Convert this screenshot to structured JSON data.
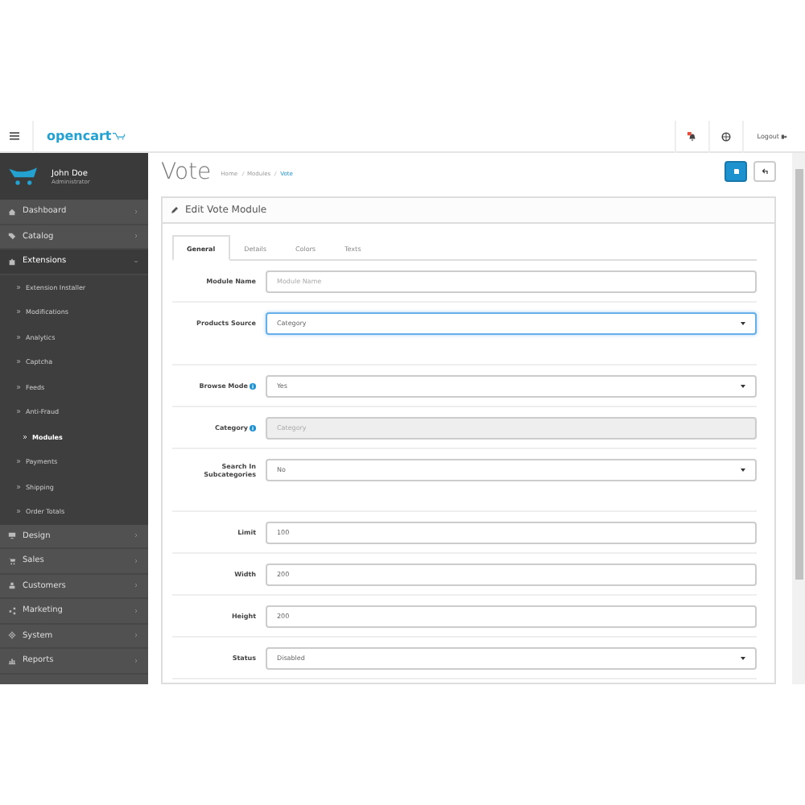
{
  "header": {
    "logo": "opencart",
    "logout": "Logout",
    "notification": true
  },
  "profile": {
    "name": "John Doe",
    "role": "Administrator"
  },
  "nav": [
    {
      "label": "Dashboard",
      "expanded": false,
      "selected": false
    },
    {
      "label": "Catalog",
      "expanded": false,
      "selected": false
    },
    {
      "label": "Extensions",
      "expanded": true,
      "selected": true,
      "children": [
        {
          "label": "Extension Installer",
          "selected": false
        },
        {
          "label": "Modifications",
          "selected": false
        },
        {
          "label": "Analytics",
          "selected": false
        },
        {
          "label": "Captcha",
          "selected": false
        },
        {
          "label": "Feeds",
          "selected": false
        },
        {
          "label": "Anti-Fraud",
          "selected": false
        },
        {
          "label": "Modules",
          "selected": true
        },
        {
          "label": "Payments",
          "selected": false
        },
        {
          "label": "Shipping",
          "selected": false
        },
        {
          "label": "Order Totals",
          "selected": false
        }
      ]
    },
    {
      "label": "Design",
      "expanded": false,
      "selected": false
    },
    {
      "label": "Sales",
      "expanded": false,
      "selected": false
    },
    {
      "label": "Customers",
      "expanded": false,
      "selected": false
    },
    {
      "label": "Marketing",
      "expanded": false,
      "selected": false
    },
    {
      "label": "System",
      "expanded": false,
      "selected": false
    },
    {
      "label": "Reports",
      "expanded": false,
      "selected": false
    }
  ],
  "page": {
    "title": "Vote",
    "breadcrumbs": [
      "Home",
      "Modules",
      "Vote"
    ]
  },
  "panel": {
    "title": "Edit Vote Module"
  },
  "tabs": [
    {
      "label": "General",
      "selected": true
    },
    {
      "label": "Details",
      "selected": false
    },
    {
      "label": "Colors",
      "selected": false
    },
    {
      "label": "Texts",
      "selected": false
    }
  ],
  "fields": [
    {
      "label": "Module Name",
      "kind": "text",
      "placeholder": "Module Name",
      "help": false,
      "disabled": false,
      "focused": false,
      "gap_after": false
    },
    {
      "label": "Products Source",
      "kind": "select",
      "value": "Category",
      "help": false,
      "disabled": false,
      "focused": true,
      "gap_after": true
    },
    {
      "label": "Browse Mode",
      "kind": "select",
      "value": "Yes",
      "help": true,
      "disabled": false,
      "focused": false,
      "gap_after": false
    },
    {
      "label": "Category",
      "kind": "text",
      "placeholder": "Category",
      "help": true,
      "disabled": true,
      "focused": false,
      "gap_after": false
    },
    {
      "label": "Search In Subcategories",
      "kind": "select",
      "value": "No",
      "help": false,
      "disabled": false,
      "focused": false,
      "gap_after": true
    },
    {
      "label": "Limit",
      "kind": "text",
      "value": "100",
      "help": false,
      "disabled": false,
      "focused": false,
      "gap_after": false
    },
    {
      "label": "Width",
      "kind": "text",
      "value": "200",
      "help": false,
      "disabled": false,
      "focused": false,
      "gap_after": false
    },
    {
      "label": "Height",
      "kind": "text",
      "value": "200",
      "help": false,
      "disabled": false,
      "focused": false,
      "gap_after": false
    },
    {
      "label": "Status",
      "kind": "select",
      "value": "Disabled",
      "help": false,
      "disabled": false,
      "focused": false,
      "gap_after": false
    }
  ]
}
